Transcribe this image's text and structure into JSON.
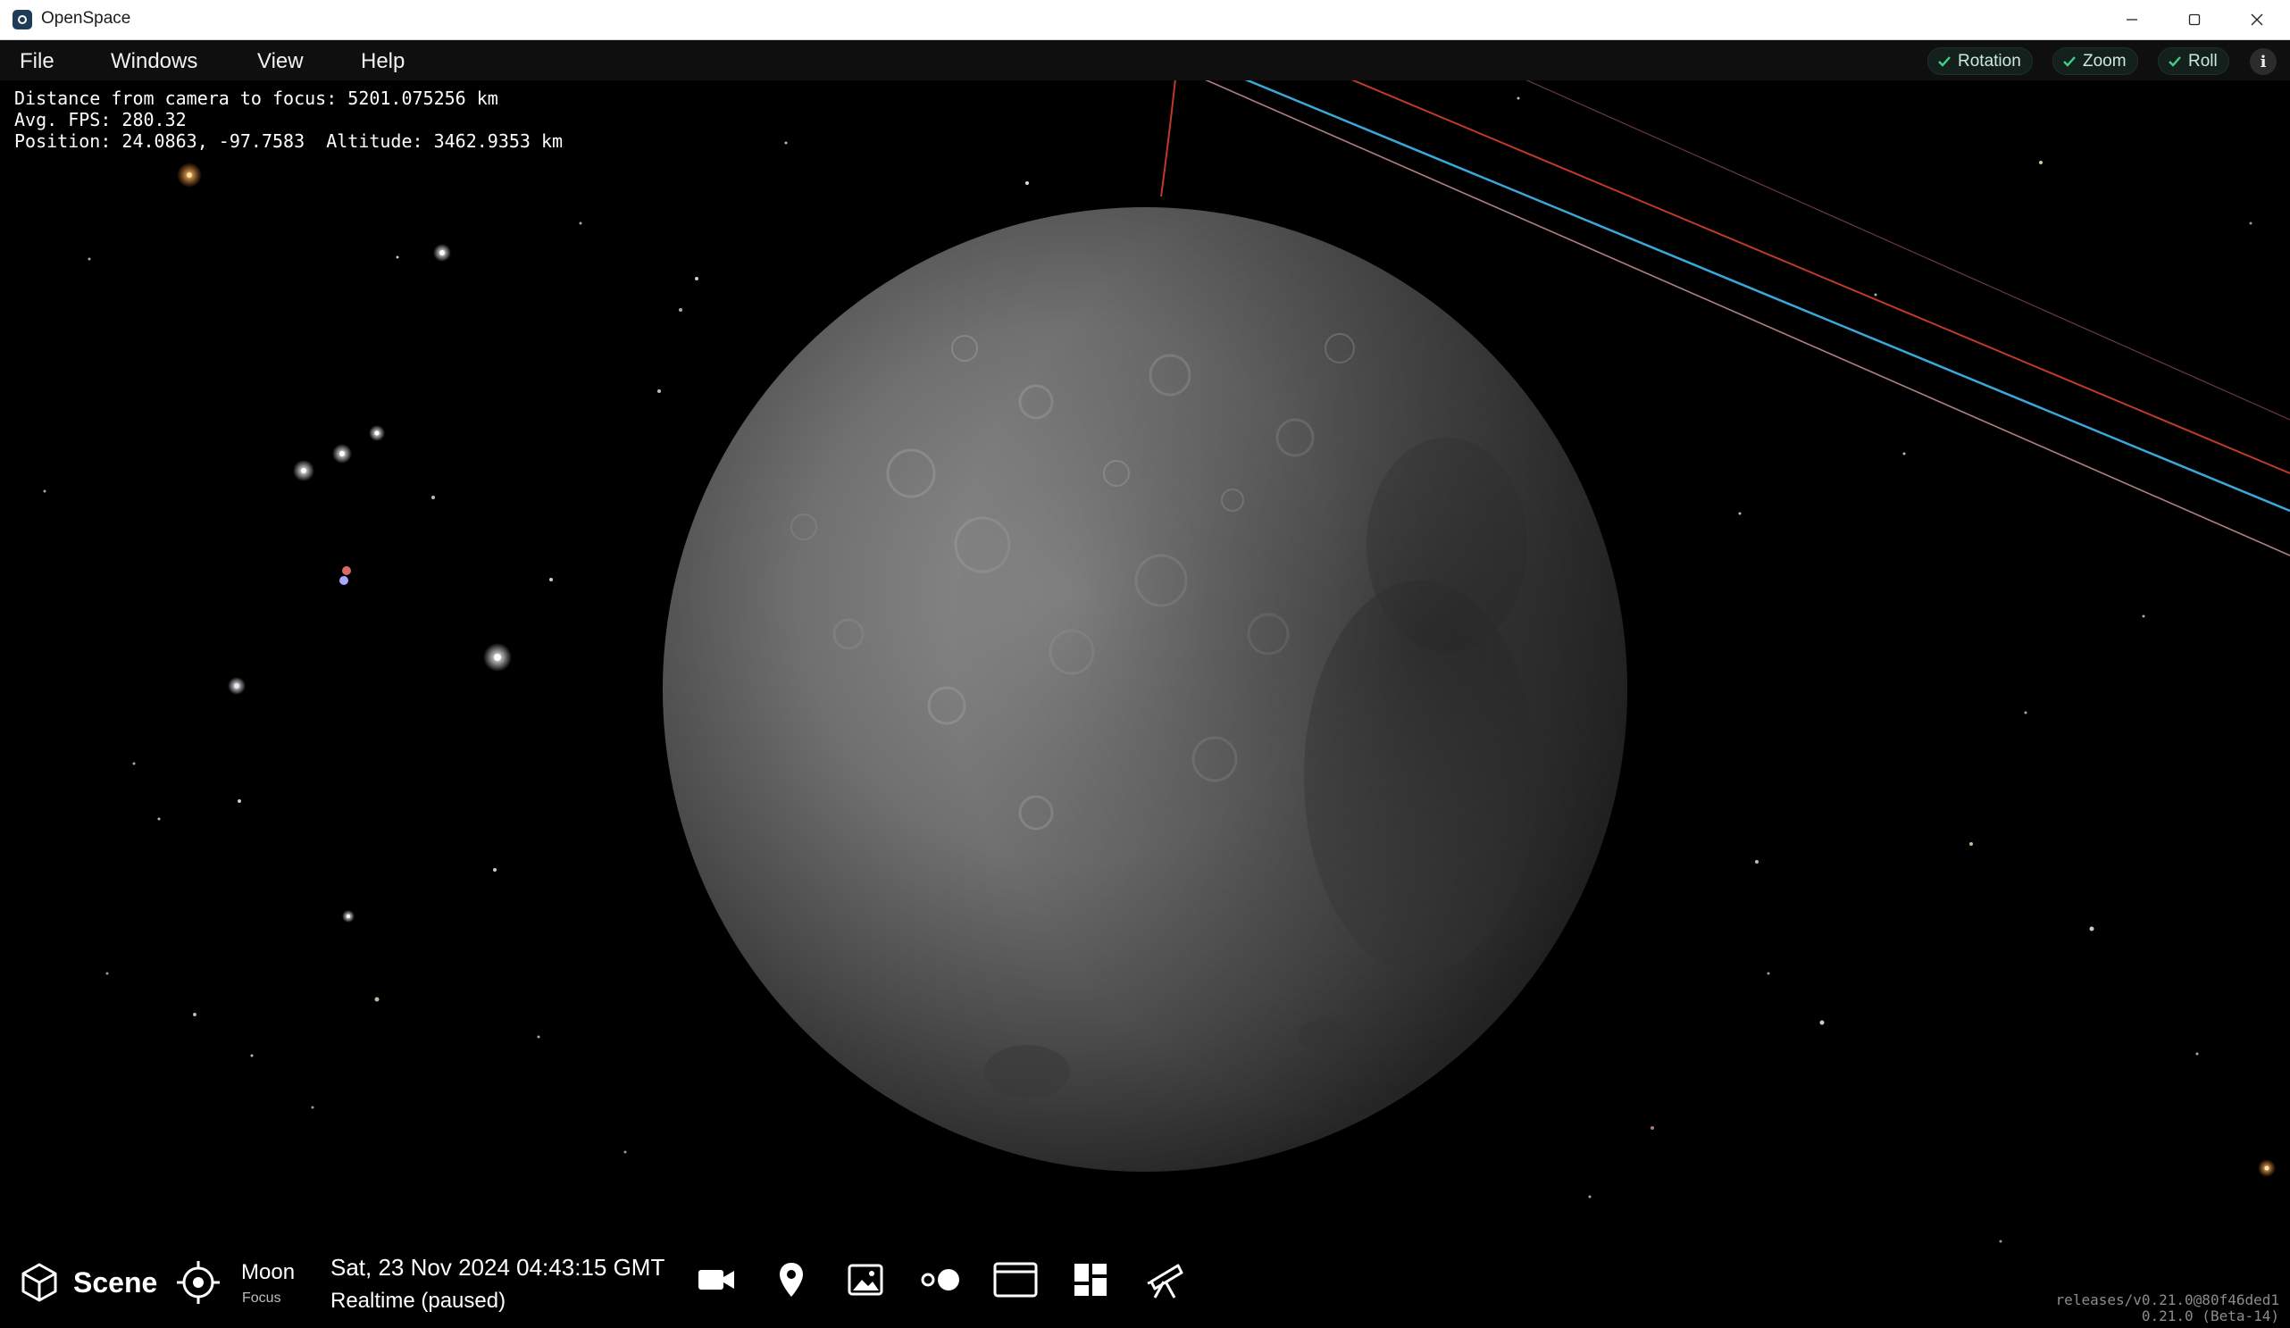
{
  "window": {
    "title": "OpenSpace",
    "controls": [
      "minimize-icon",
      "maximize-icon",
      "close-icon"
    ]
  },
  "menu": {
    "items": [
      "File",
      "Windows",
      "View",
      "Help"
    ]
  },
  "camera_toggles": [
    {
      "label": "Rotation",
      "checked": true
    },
    {
      "label": "Zoom",
      "checked": true
    },
    {
      "label": "Roll",
      "checked": true
    }
  ],
  "info_button": {
    "label": "i"
  },
  "stats": {
    "distance": "Distance from camera to focus: 5201.075256 km",
    "fps": "Avg. FPS: 280.32",
    "position": "Position: 24.0863, -97.7583  Altitude: 3462.9353 km"
  },
  "bottom_bar": {
    "scene_label": "Scene",
    "focus_name": "Moon",
    "focus_label": "Focus",
    "date": "Sat, 23 Nov 2024 04:43:15 GMT",
    "time_mode": "Realtime (paused)",
    "tools": [
      "camera-icon",
      "map-pin-icon",
      "image-icon",
      "dots-icon",
      "window-icon",
      "dashboard-icon",
      "telescope-icon"
    ]
  },
  "version": {
    "line1": "releases/v0.21.0@80f46ded1",
    "line2": "0.21.0 (Beta-14)"
  },
  "colors": {
    "accent_green": "#3fd18a",
    "orbit_blue": "#3aa8d8",
    "orbit_red": "#c0392b",
    "orbit_pink": "#b08080"
  }
}
